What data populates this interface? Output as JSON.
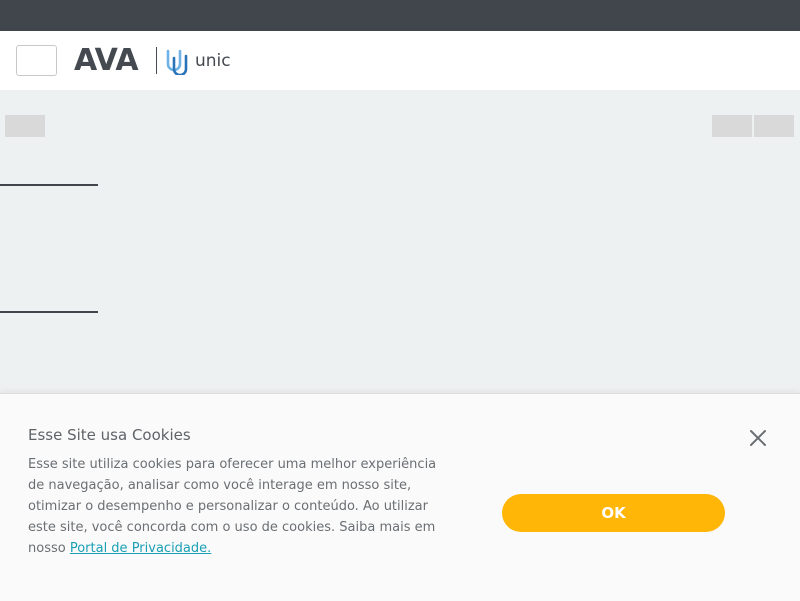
{
  "header": {
    "logo_text": "AVA",
    "brand_text": "unic"
  },
  "cookie_banner": {
    "title": "Esse Site usa Cookies",
    "body": "Esse site utiliza cookies para oferecer uma melhor experiência de navegação, analisar como você interage em nosso site, otimizar o desempenho e personalizar o conteúdo. Ao utilizar este site, você concorda com o uso de cookies. Saiba mais em nosso ",
    "link_text": "Portal de Privacidade.",
    "ok_label": "OK",
    "close_icon": "close-icon"
  },
  "colors": {
    "topbar": "#41464d",
    "accent_button": "#ffb606",
    "link": "#1a9fb5",
    "brand_blue": "#3c8fd0"
  }
}
